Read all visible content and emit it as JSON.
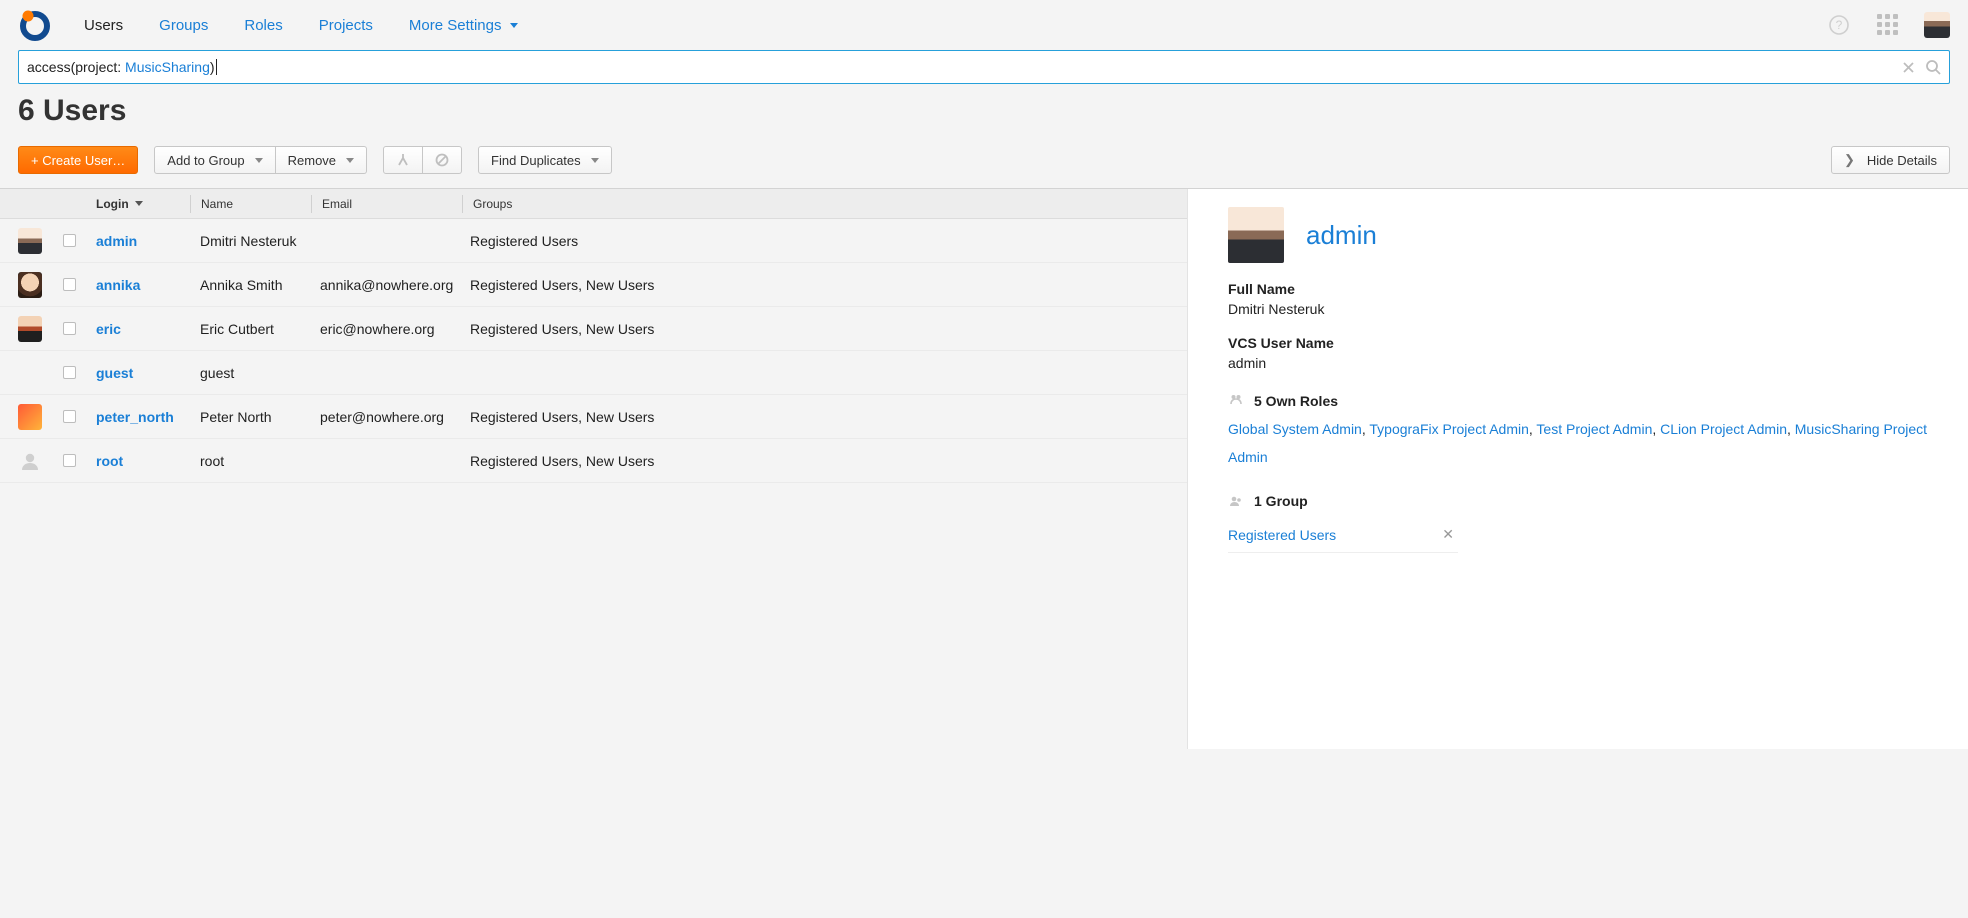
{
  "nav": {
    "items": [
      {
        "label": "Users",
        "active": true
      },
      {
        "label": "Groups"
      },
      {
        "label": "Roles"
      },
      {
        "label": "Projects"
      },
      {
        "label": "More Settings",
        "dropdown": true
      }
    ]
  },
  "search": {
    "prefix": "access(project: ",
    "value": "MusicSharing",
    "suffix": ")"
  },
  "title": "6 Users",
  "toolbar": {
    "create": "+ Create User…",
    "add_to_group": "Add to Group",
    "remove": "Remove",
    "find_duplicates": "Find Duplicates",
    "hide_details": "Hide Details"
  },
  "columns": {
    "login": "Login",
    "name": "Name",
    "email": "Email",
    "groups": "Groups"
  },
  "users": [
    {
      "login": "admin",
      "name": "Dmitri Nesteruk",
      "email": "",
      "groups": "Registered Users",
      "avatar": "av-1"
    },
    {
      "login": "annika",
      "name": "Annika Smith",
      "email": "annika@nowhere.org",
      "groups": "Registered Users, New Users",
      "avatar": "av-2"
    },
    {
      "login": "eric",
      "name": "Eric Cutbert",
      "email": "eric@nowhere.org",
      "groups": "Registered Users, New Users",
      "avatar": "av-3"
    },
    {
      "login": "guest",
      "name": "guest",
      "email": "",
      "groups": "",
      "avatar": "guest"
    },
    {
      "login": "peter_north",
      "name": "Peter North",
      "email": "peter@nowhere.org",
      "groups": "Registered Users, New Users",
      "avatar": "av-5"
    },
    {
      "login": "root",
      "name": "root",
      "email": "",
      "groups": "Registered Users, New Users",
      "avatar": "root"
    }
  ],
  "details": {
    "login": "admin",
    "full_name_label": "Full Name",
    "full_name": "Dmitri Nesteruk",
    "vcs_label": "VCS User Name",
    "vcs": "admin",
    "roles_title": "5 Own Roles",
    "roles": [
      "Global System Admin",
      "TypograFix Project Admin",
      "Test Project Admin",
      "CLion Project Admin",
      "MusicSharing Project Admin"
    ],
    "groups_title": "1 Group",
    "group": "Registered Users"
  }
}
